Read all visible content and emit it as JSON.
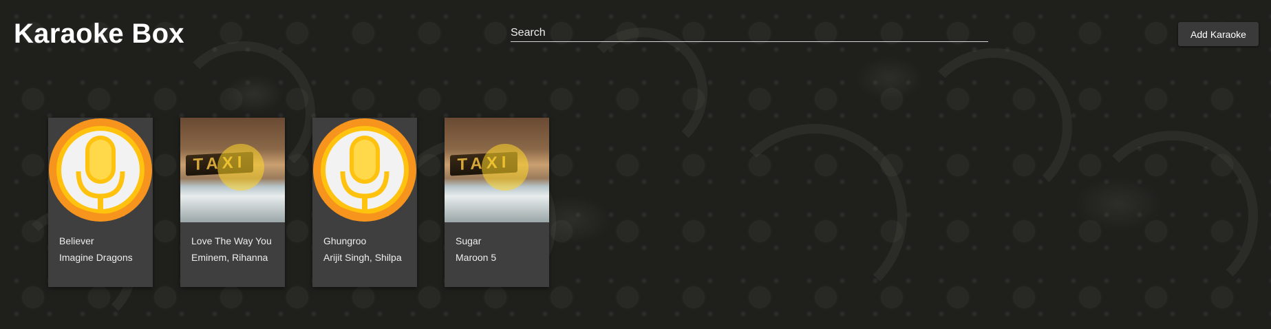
{
  "app": {
    "title": "Karaoke Box"
  },
  "search": {
    "placeholder": "Search"
  },
  "toolbar": {
    "add_label": "Add Karaoke"
  },
  "colors": {
    "mic_orange": "#f7941d",
    "mic_yellow": "#ffc20e",
    "card_bg": "#3f3f3f"
  },
  "cards": [
    {
      "song": "Believer",
      "artist": "Imagine Dragons",
      "thumbnail": "microphone-icon"
    },
    {
      "song": "Love The Way You",
      "artist": "Eminem, Rihanna",
      "thumbnail": "taxi-photo"
    },
    {
      "song": "Ghungroo",
      "artist": "Arijit Singh, Shilpa",
      "thumbnail": "microphone-icon"
    },
    {
      "song": "Sugar",
      "artist": "Maroon 5",
      "thumbnail": "taxi-photo"
    }
  ]
}
